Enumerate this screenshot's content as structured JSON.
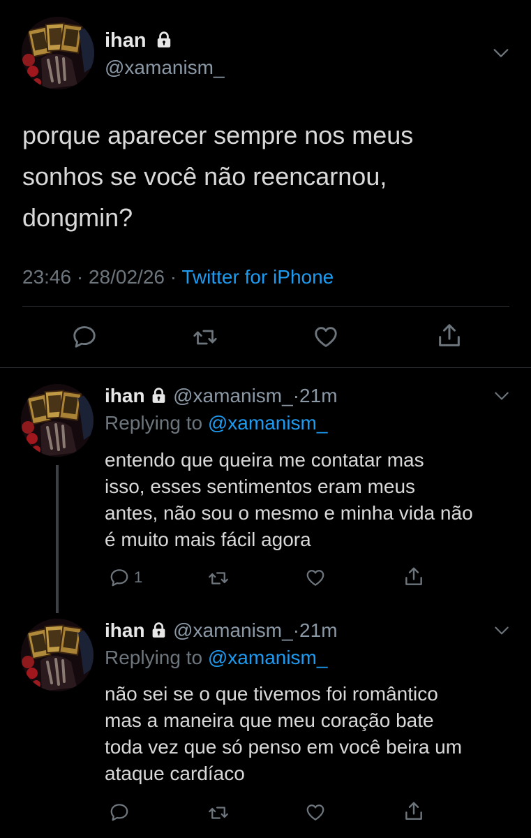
{
  "main_tweet": {
    "name": "ihan",
    "handle": "@xamanism_",
    "text_lines": [
      "porque aparecer sempre nos meus",
      "sonhos se você não reencarnou,",
      "dongmin?"
    ],
    "time": "23:46",
    "sep1": "·",
    "date": "28/02/26",
    "sep2": "·",
    "source": "Twitter for iPhone"
  },
  "replies": [
    {
      "name": "ihan",
      "handle": "@xamanism_",
      "dot": "·",
      "time": "21m",
      "replying_prefix": "Replying to",
      "replying_to": "@xamanism_",
      "text_lines": [
        "entendo que queira me contatar mas",
        "isso, esses sentimentos eram meus",
        "antes, não sou o mesmo e minha vida não",
        "é muito mais fácil agora"
      ],
      "reply_count": "1"
    },
    {
      "name": "ihan",
      "handle": "@xamanism_",
      "dot": "·",
      "time": "21m",
      "replying_prefix": "Replying to",
      "replying_to": "@xamanism_",
      "text_lines": [
        "não sei se o que tivemos foi romântico",
        "mas a maneira que meu coração bate",
        "toda vez que só penso em você beira um",
        "ataque cardíaco"
      ],
      "reply_count": ""
    }
  ],
  "icons": [
    "lock-icon",
    "chevron-down-icon",
    "reply-icon",
    "retweet-icon",
    "like-icon",
    "share-icon"
  ],
  "colors": {
    "background": "#000000",
    "text": "#d9d9d9",
    "muted": "#6e767d",
    "link": "#1d9bf0",
    "divider": "#2f3336"
  }
}
